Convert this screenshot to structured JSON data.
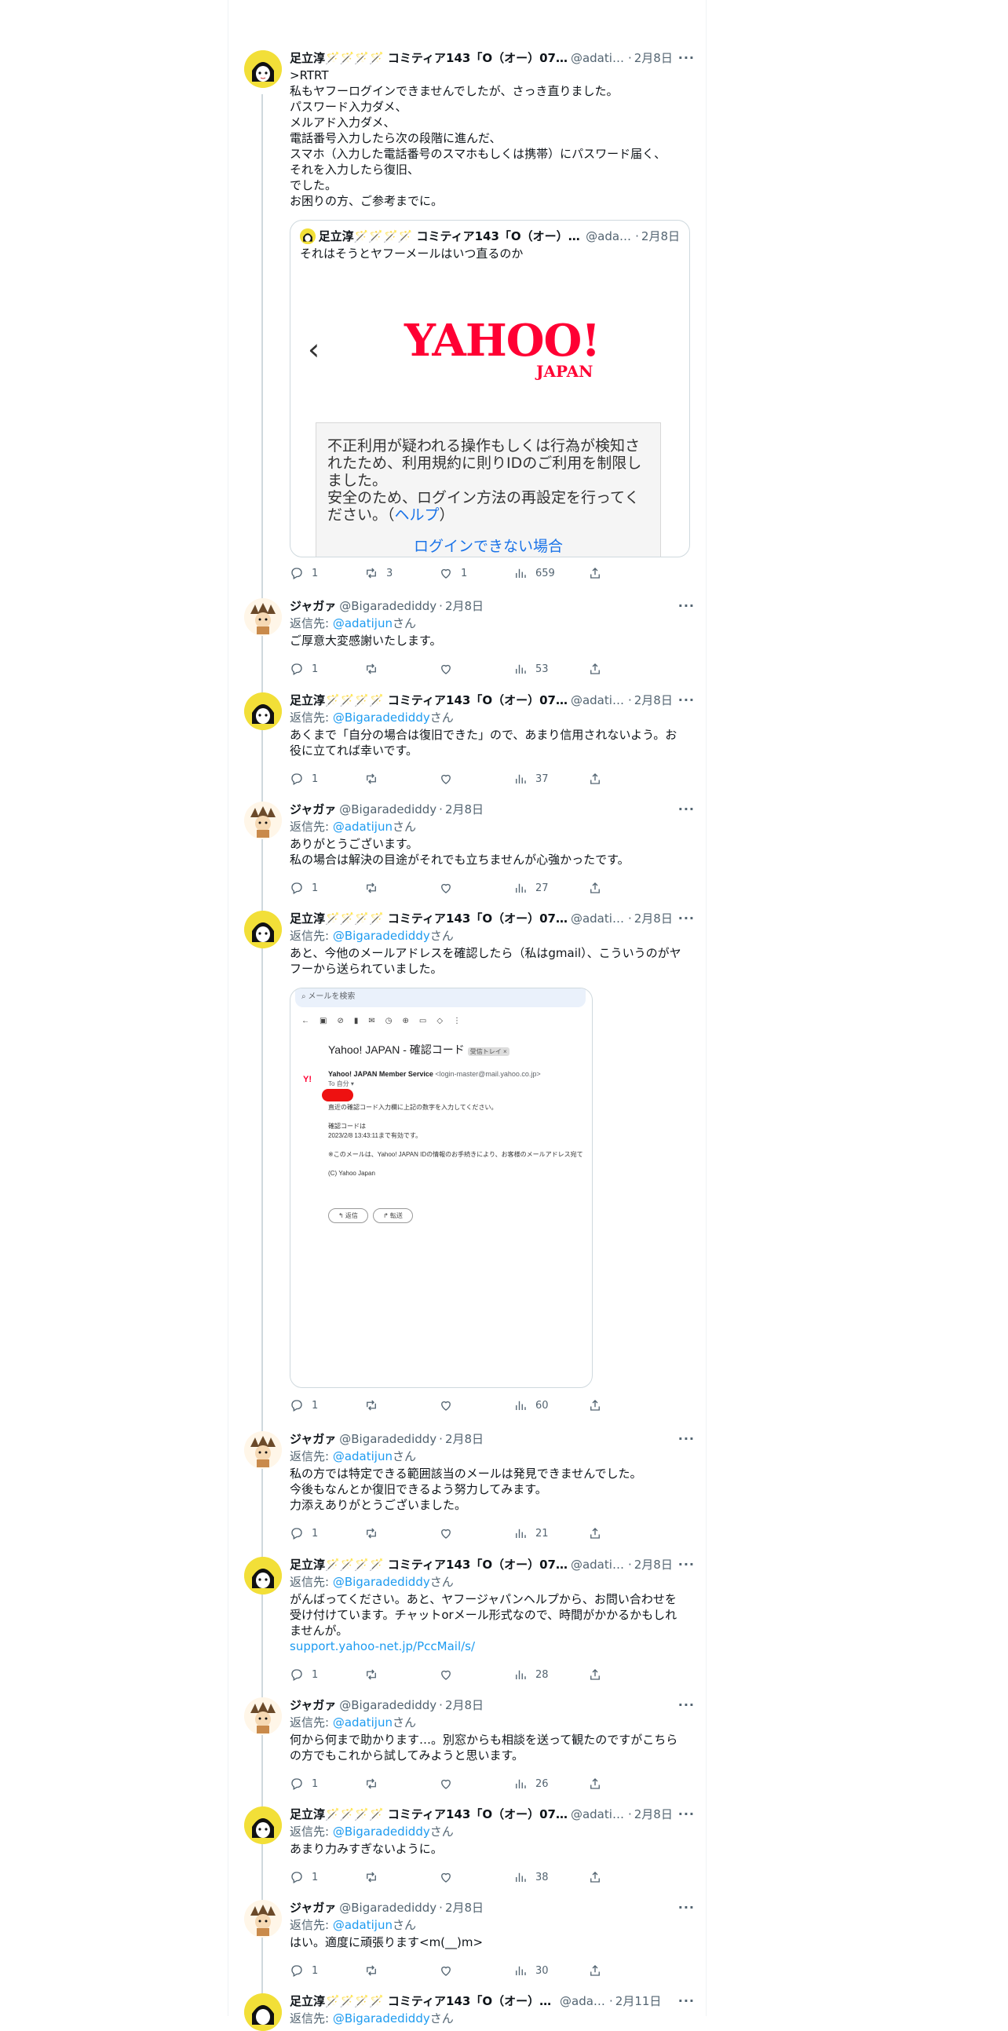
{
  "authors": {
    "adachi": {
      "name": "足立淳🪄🪄🪄🪄 コミティア143「O（オー）07…",
      "handle": "@adatij…"
    },
    "jagaa": {
      "name": "ジャガァ",
      "handle": "@Bigaradediddy"
    }
  },
  "icons": {
    "reply": "reply-icon",
    "retweet": "retweet-icon",
    "like": "like-icon",
    "views": "views-icon",
    "share": "share-icon",
    "more": "more-icon"
  },
  "colors": {
    "link": "#1d9bf0",
    "thread_line": "#cfd9de",
    "yahoo_red": "#ff0033"
  },
  "tweets": [
    {
      "name": "足立淳🪄🪄🪄🪄 コミティア143「O（オー）07…",
      "handle": "@adatij…",
      "date": "2月8日",
      "lines": [
        ">RTRT",
        "私もヤフーログインできませんでしたが、さっき直りました。",
        "パスワード入力ダメ、",
        "メルアド入力ダメ、",
        "電話番号入力したら次の段階に進んだ、",
        "スマホ（入力した電話番号のスマホもしくは携帯）にパスワード届く、",
        "それを入力したら復旧、",
        "でした。",
        "お困りの方、ご参考までに。"
      ],
      "quote": {
        "name": "足立淳🪄🪄🪄🪄 コミティア143「O（オー）0…",
        "handle": "@adati…",
        "date": "2月8日",
        "text": "それはそうとヤフーメールはいつ直るのか",
        "logo": "YAHOO!",
        "logo_sub": "JAPAN",
        "notice_1": "不正利用が疑われる操作もしくは行為が検知されたため、利用規約に則りIDのご利用を制限しました。",
        "notice_2": "安全のため、ログイン方法の再設定を行ってください。（",
        "notice_help": "ヘルプ",
        "notice_close": "）",
        "notice_link": "ログインできない場合"
      },
      "stats": {
        "replies": "1",
        "retweets": "3",
        "likes": "1",
        "views": "659"
      }
    },
    {
      "name": "ジャガァ",
      "handle": "@Bigaradediddy",
      "date": "2月8日",
      "reply_prefix": "返信先: ",
      "reply_to": "@adatijun",
      "reply_suffix": "さん",
      "lines": [
        "ご厚意大変感謝いたします。"
      ],
      "stats": {
        "replies": "1",
        "retweets": "",
        "likes": "",
        "views": "53"
      }
    },
    {
      "name": "足立淳🪄🪄🪄🪄 コミティア143「O（オー）07…",
      "handle": "@adatij…",
      "date": "2月8日",
      "reply_prefix": "返信先: ",
      "reply_to": "@Bigaradediddy",
      "reply_suffix": "さん",
      "lines": [
        "あくまで「自分の場合は復旧できた」ので、あまり信用されないよう。お",
        "役に立てれば幸いです。"
      ],
      "stats": {
        "replies": "1",
        "retweets": "",
        "likes": "",
        "views": "37"
      }
    },
    {
      "name": "ジャガァ",
      "handle": "@Bigaradediddy",
      "date": "2月8日",
      "reply_prefix": "返信先: ",
      "reply_to": "@adatijun",
      "reply_suffix": "さん",
      "lines": [
        "ありがとうございます。",
        "私の場合は解決の目途がそれでも立ちませんが心強かったです。"
      ],
      "stats": {
        "replies": "1",
        "retweets": "",
        "likes": "",
        "views": "27"
      }
    },
    {
      "name": "足立淳🪄🪄🪄🪄 コミティア143「O（オー）07…",
      "handle": "@adatij…",
      "date": "2月8日",
      "reply_prefix": "返信先: ",
      "reply_to": "@Bigaradediddy",
      "reply_suffix": "さん",
      "lines": [
        "あと、今他のメールアドレスを確認したら（私はgmail）、こういうのがヤ",
        "フーから送られていました。"
      ],
      "gmail": {
        "search": "メールを検索",
        "subject": "Yahoo! JAPAN - 確認コード",
        "tag": "受信トレイ ×",
        "logo": "Y!",
        "sender": "Yahoo! JAPAN Member Service",
        "sender_addr": "<login-master@mail.yahoo.co.jp>",
        "to": "To 自分 ▾",
        "body_1": "直近の確認コード入力欄に上記の数字を入力してください。",
        "body_2": "確認コードは",
        "body_3": "2023/2/8 13:43:11まで有効です。",
        "body_4": "※このメールは、Yahoo! JAPAN IDの情報のお手続きにより、お客様のメールアドレス宛て",
        "body_5": "(C) Yahoo Japan",
        "reply_btn": "↰ 返信",
        "forward_btn": "↱ 転送"
      },
      "stats": {
        "replies": "1",
        "retweets": "",
        "likes": "",
        "views": "60"
      }
    },
    {
      "name": "ジャガァ",
      "handle": "@Bigaradediddy",
      "date": "2月8日",
      "reply_prefix": "返信先: ",
      "reply_to": "@adatijun",
      "reply_suffix": "さん",
      "lines": [
        "私の方では特定できる範囲該当のメールは発見できませんでした。",
        "今後もなんとか復旧できるよう努力してみます。",
        "力添えありがとうございました。"
      ],
      "stats": {
        "replies": "1",
        "retweets": "",
        "likes": "",
        "views": "21"
      }
    },
    {
      "name": "足立淳🪄🪄🪄🪄 コミティア143「O（オー）07…",
      "handle": "@adatij…",
      "date": "2月8日",
      "reply_prefix": "返信先: ",
      "reply_to": "@Bigaradediddy",
      "reply_suffix": "さん",
      "lines": [
        "がんばってください。あと、ヤフージャパンヘルプから、お問い合わせを",
        "受け付けています。チャットorメール形式なので、時間がかかるかもしれ",
        "ませんが。"
      ],
      "link": "support.yahoo-net.jp/PccMail/s/",
      "stats": {
        "replies": "1",
        "retweets": "",
        "likes": "",
        "views": "28"
      }
    },
    {
      "name": "ジャガァ",
      "handle": "@Bigaradediddy",
      "date": "2月8日",
      "reply_prefix": "返信先: ",
      "reply_to": "@adatijun",
      "reply_suffix": "さん",
      "lines": [
        "何から何まで助かります…。別窓からも相談を送って観たのですがこちら",
        "の方でもこれから試してみようと思います。"
      ],
      "stats": {
        "replies": "1",
        "retweets": "",
        "likes": "",
        "views": "26"
      }
    },
    {
      "name": "足立淳🪄🪄🪄🪄 コミティア143「O（オー）07…",
      "handle": "@adatij…",
      "date": "2月8日",
      "reply_prefix": "返信先: ",
      "reply_to": "@Bigaradediddy",
      "reply_suffix": "さん",
      "lines": [
        "あまり力みすぎないように。"
      ],
      "stats": {
        "replies": "1",
        "retweets": "",
        "likes": "",
        "views": "38"
      }
    },
    {
      "name": "ジャガァ",
      "handle": "@Bigaradediddy",
      "date": "2月8日",
      "reply_prefix": "返信先: ",
      "reply_to": "@adatijun",
      "reply_suffix": "さん",
      "lines": [
        "はい。適度に頑張ります<m(__)m>"
      ],
      "stats": {
        "replies": "1",
        "retweets": "",
        "likes": "",
        "views": "30"
      }
    },
    {
      "name": "足立淳🪄🪄🪄🪄 コミティア143「O（オー）0…",
      "handle": "@adati…",
      "date": "2月11日",
      "reply_prefix": "返信先: ",
      "reply_to": "@Bigaradediddy",
      "reply_suffix": "さん",
      "lines": [],
      "stats": {
        "replies": "",
        "retweets": "",
        "likes": "",
        "views": ""
      }
    }
  ]
}
